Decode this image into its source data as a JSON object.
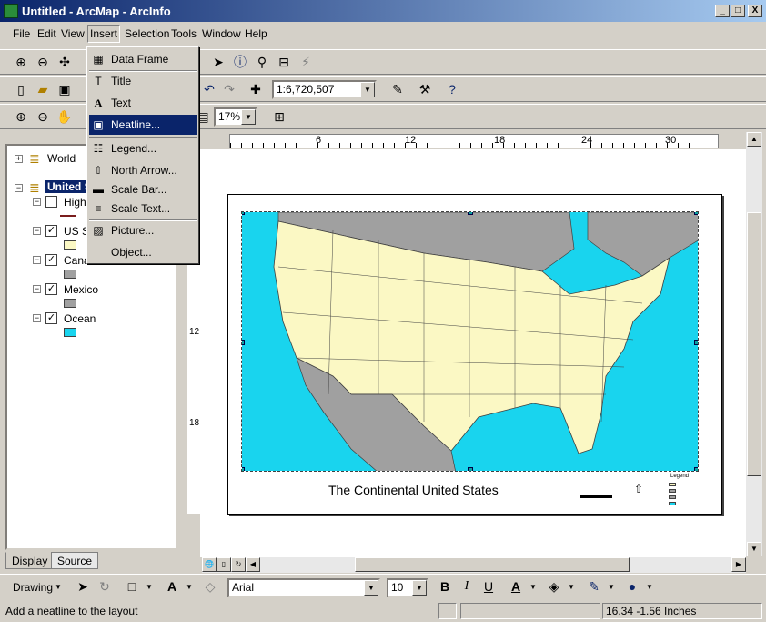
{
  "window": {
    "title": "Untitled - ArcMap - ArcInfo",
    "controls": [
      "_",
      "□",
      "X"
    ]
  },
  "menubar": {
    "items": [
      {
        "label": "File"
      },
      {
        "label": "Edit"
      },
      {
        "label": "View"
      },
      {
        "label": "Insert"
      },
      {
        "label": "Selection"
      },
      {
        "label": "Tools"
      },
      {
        "label": "Window"
      },
      {
        "label": "Help"
      }
    ]
  },
  "insert_menu": {
    "items": [
      {
        "label": "Data Frame",
        "icon": "data-frame-icon",
        "glyph": "▦"
      },
      {
        "label": "Title",
        "icon": "title-icon",
        "glyph": "T"
      },
      {
        "label": "Text",
        "icon": "text-icon",
        "glyph": "A"
      },
      {
        "label": "Neatline...",
        "icon": "neatline-icon",
        "glyph": "▣"
      },
      {
        "label": "Legend...",
        "icon": "legend-icon",
        "glyph": "☷"
      },
      {
        "label": "North Arrow...",
        "icon": "north-arrow-icon",
        "glyph": "⇧"
      },
      {
        "label": "Scale Bar...",
        "icon": "scale-bar-icon",
        "glyph": "▬"
      },
      {
        "label": "Scale Text...",
        "icon": "scale-text-icon",
        "glyph": "≡"
      },
      {
        "label": "Picture...",
        "icon": "picture-icon",
        "glyph": "▨"
      },
      {
        "label": "Object...",
        "icon": "object-icon",
        "glyph": ""
      }
    ],
    "highlighted": "Neatline..."
  },
  "toolbar": {
    "scale": "1:6,720,507",
    "zoom": "17%"
  },
  "toc": {
    "world": "World",
    "united_states": "United S",
    "layers": [
      {
        "name": "Highw",
        "checked": false,
        "swatch": "#7a1d1d"
      },
      {
        "name": "US St",
        "checked": true,
        "swatch": "#fbf8c4"
      },
      {
        "name": "Cana",
        "checked": true,
        "swatch": "#a0a0a0"
      },
      {
        "name": "Mexico",
        "checked": true,
        "swatch": "#a0a0a0"
      },
      {
        "name": "Ocean",
        "checked": true,
        "swatch": "#19d4ee"
      }
    ],
    "tabs": [
      "Display",
      "Source"
    ]
  },
  "rulers": {
    "horizontal": [
      "6",
      "12",
      "18",
      "24",
      "30"
    ],
    "vertical": [
      "12",
      "18"
    ]
  },
  "layout": {
    "map_title": "The Continental United States",
    "legend_title": "Legend",
    "north_label": "N",
    "colors": {
      "land": "#fbf8c4",
      "ocean": "#19d4ee",
      "other_land": "#a0a0a0"
    }
  },
  "drawing_toolbar": {
    "label": "Drawing",
    "font": "Arial",
    "font_size": "10",
    "bold": "B",
    "italic": "I",
    "underline": "U"
  },
  "status": {
    "message": "Add a neatline to the layout",
    "coords": "16.34  -1.56 Inches"
  }
}
